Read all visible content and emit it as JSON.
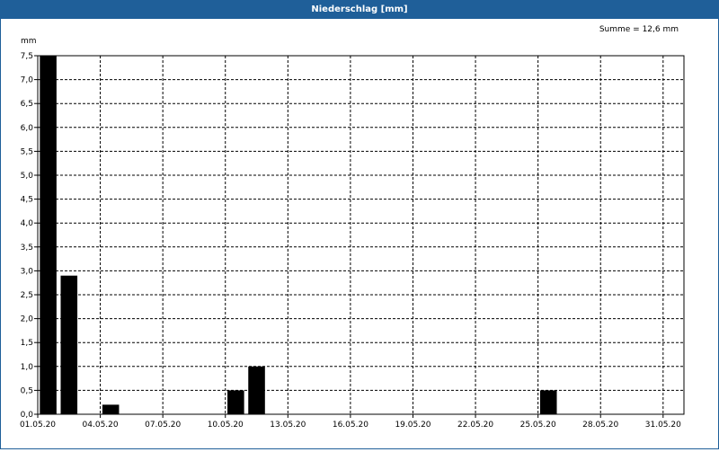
{
  "chart_data": {
    "type": "bar",
    "title": "Niederschlag [mm]",
    "ylabel": "mm",
    "summary": "Summe = 12,6 mm",
    "ylim": [
      0,
      7.5
    ],
    "yticks": [
      "0,0",
      "0,5",
      "1,0",
      "1,5",
      "2,0",
      "2,5",
      "3,0",
      "3,5",
      "4,0",
      "4,5",
      "5,0",
      "5,5",
      "6,0",
      "6,5",
      "7,0",
      "7,5"
    ],
    "xticks": [
      "01.05.20",
      "04.05.20",
      "07.05.20",
      "10.05.20",
      "13.05.20",
      "16.05.20",
      "19.05.20",
      "22.05.20",
      "25.05.20",
      "28.05.20",
      "31.05.20"
    ],
    "grid": true,
    "categories": [
      "01.05.20",
      "02.05.20",
      "03.05.20",
      "04.05.20",
      "05.05.20",
      "06.05.20",
      "07.05.20",
      "08.05.20",
      "09.05.20",
      "10.05.20",
      "11.05.20",
      "12.05.20",
      "13.05.20",
      "14.05.20",
      "15.05.20",
      "16.05.20",
      "17.05.20",
      "18.05.20",
      "19.05.20",
      "20.05.20",
      "21.05.20",
      "22.05.20",
      "23.05.20",
      "24.05.20",
      "25.05.20",
      "26.05.20",
      "27.05.20",
      "28.05.20",
      "29.05.20",
      "30.05.20",
      "31.05.20"
    ],
    "values": [
      7.5,
      2.9,
      0,
      0.2,
      0,
      0,
      0,
      0,
      0,
      0.5,
      1.0,
      0,
      0,
      0,
      0,
      0,
      0,
      0,
      0,
      0,
      0,
      0,
      0,
      0,
      0.5,
      0,
      0,
      0,
      0,
      0,
      0
    ],
    "colors": {
      "bar": "#000000",
      "grid": "#000000",
      "title_bar": "#1f5f99"
    }
  }
}
